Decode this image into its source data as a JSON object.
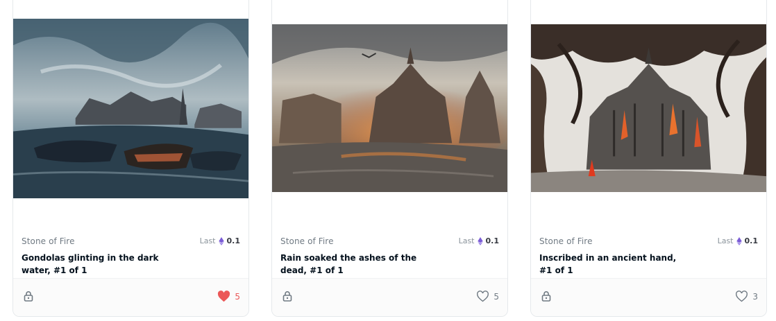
{
  "cards": [
    {
      "collection": "Stone of Fire",
      "title": "Gondolas glinting in the dark water, #1 of 1",
      "last_label": "Last",
      "price": "0.1",
      "favorites": "5",
      "liked": true,
      "image_alt": "Stormy painting of gondolas on dark water before a city skyline"
    },
    {
      "collection": "Stone of Fire",
      "title": "Rain soaked the ashes of the dead, #1 of 1",
      "last_label": "Last",
      "price": "0.1",
      "favorites": "5",
      "liked": false,
      "image_alt": "Painting of burning temples reflected in rain-soaked water"
    },
    {
      "collection": "Stone of Fire",
      "title": "Inscribed in an ancient hand, #1 of 1",
      "last_label": "Last",
      "price": "0.1",
      "favorites": "3",
      "liked": false,
      "image_alt": "Ink painting of a burning gothic cathedral under twisting tree branches"
    }
  ],
  "colors": {
    "heart_liked": "#eb5757",
    "eth_purple": "#7b5cd6",
    "text_muted": "#707a83",
    "text_dark": "#04111d"
  }
}
